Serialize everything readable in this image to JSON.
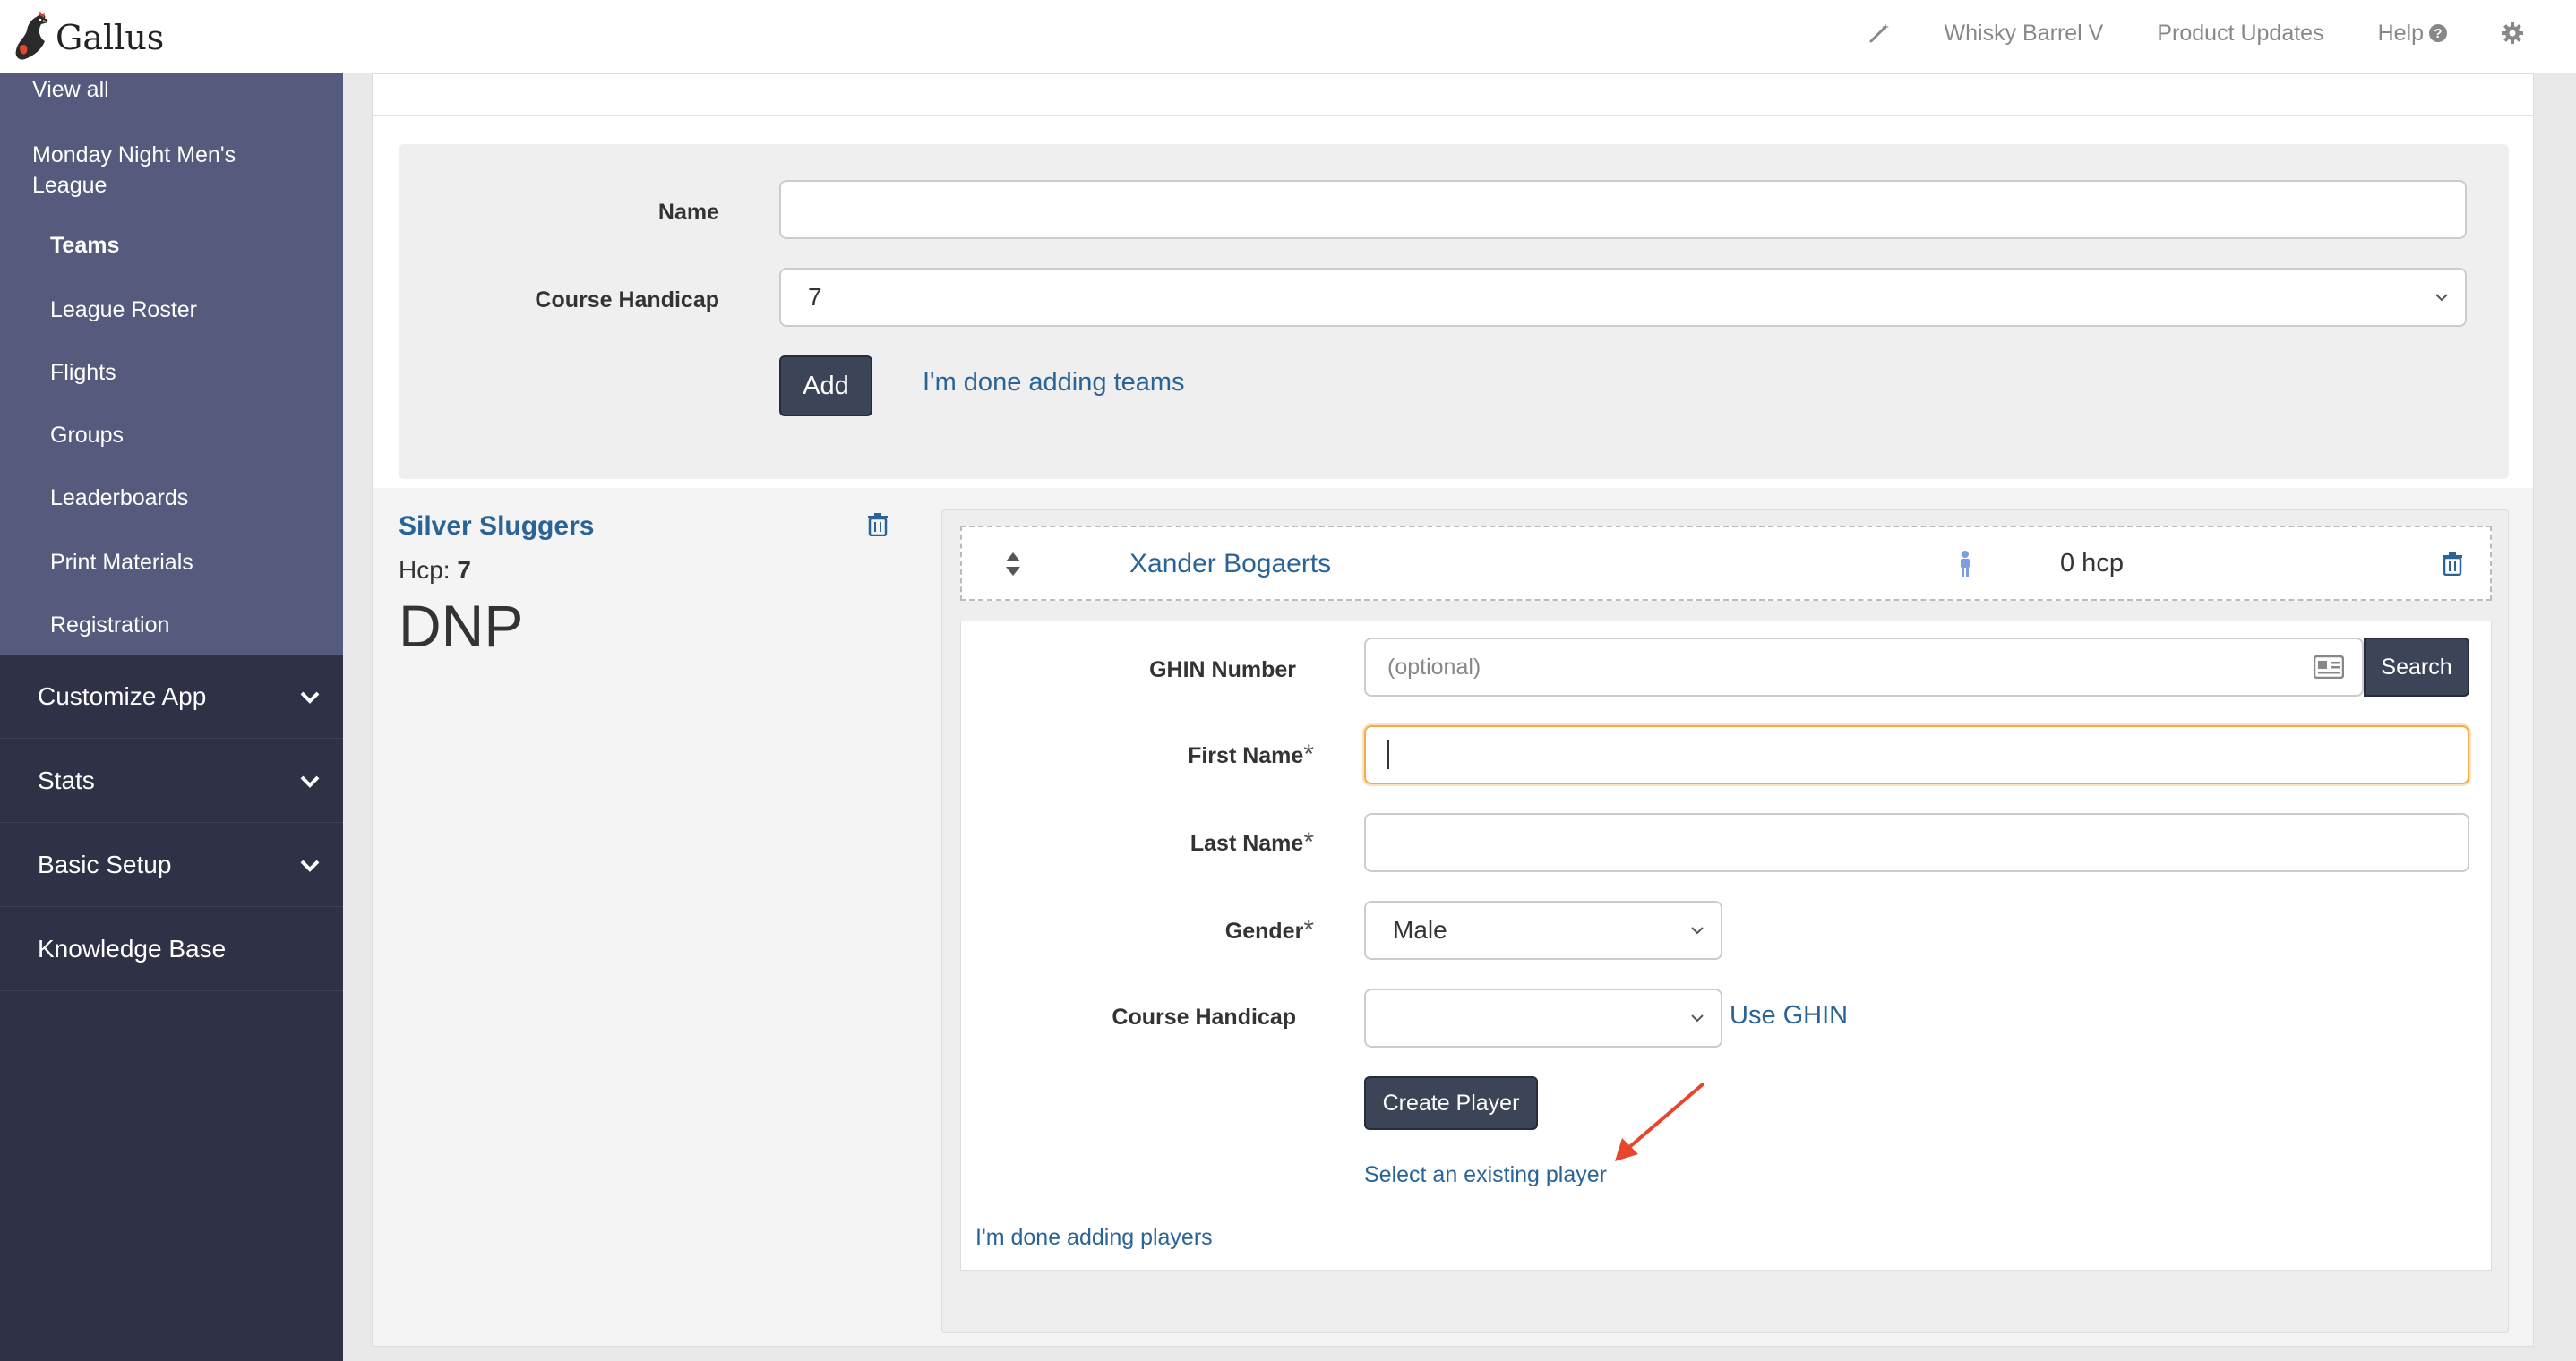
{
  "app": {
    "brand": "Gallus"
  },
  "topnav": {
    "event": "Whisky Barrel V",
    "product_updates": "Product Updates",
    "help": "Help",
    "help_q": "?"
  },
  "sidebar": {
    "view_all": "View all",
    "league_title": "Monday Night Men's League",
    "items": [
      {
        "label": "Teams",
        "active": true
      },
      {
        "label": "League Roster"
      },
      {
        "label": "Flights"
      },
      {
        "label": "Groups"
      },
      {
        "label": "Leaderboards"
      },
      {
        "label": "Print Materials"
      },
      {
        "label": "Registration"
      }
    ],
    "sections": [
      {
        "label": "Customize App",
        "expandable": true
      },
      {
        "label": "Stats",
        "expandable": true
      },
      {
        "label": "Basic Setup",
        "expandable": true
      },
      {
        "label": "Knowledge Base",
        "expandable": false
      }
    ]
  },
  "team_form": {
    "name_label": "Name",
    "name_value": "",
    "handicap_label": "Course Handicap",
    "handicap_value": "7",
    "add_label": "Add",
    "done_label": "I'm done adding teams"
  },
  "team": {
    "name": "Silver Sluggers",
    "hcp_label": "Hcp:",
    "hcp_value": "7",
    "status": "DNP",
    "players": [
      {
        "name": "Xander Bogaerts",
        "hcp": "0 hcp"
      }
    ]
  },
  "player_form": {
    "ghin_label": "GHIN Number",
    "ghin_placeholder": "(optional)",
    "search_label": "Search",
    "first_name_label": "First Name",
    "first_name_value": "",
    "last_name_label": "Last Name",
    "last_name_value": "",
    "required_mark": "*",
    "gender_label": "Gender",
    "gender_value": "Male",
    "handicap_label": "Course Handicap",
    "handicap_value": "",
    "use_ghin": "Use GHIN",
    "create_label": "Create Player",
    "select_existing": "Select an existing player",
    "done_players": "I'm done adding players"
  },
  "colors": {
    "sidebar_dark": "#2f3247",
    "sidebar_sub": "#565b7e",
    "link_blue": "#2a6496",
    "button_dark": "#3c4557",
    "focus_orange": "#f0ad4e",
    "arrow_red": "#e8452c",
    "person_icon": "#7b9fe0"
  }
}
